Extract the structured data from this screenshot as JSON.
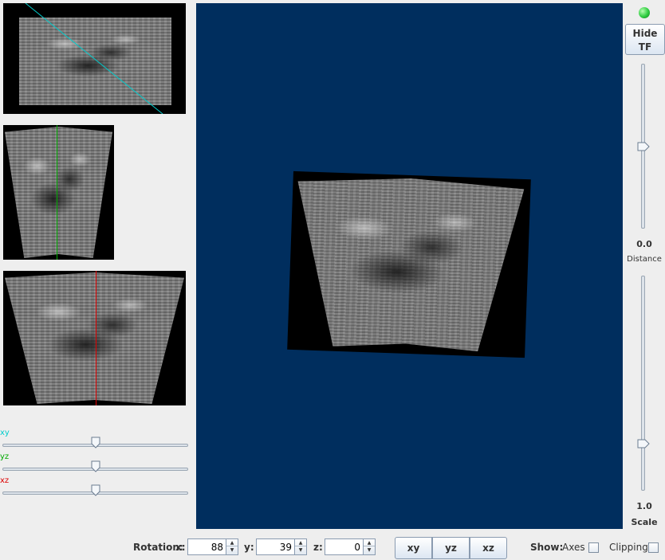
{
  "slices": {
    "xy": {
      "label": "xy",
      "color": "#00cccc"
    },
    "yz": {
      "label": "yz",
      "color": "#00aa00"
    },
    "xz": {
      "label": "xz",
      "color": "#dd0000"
    }
  },
  "sliders": {
    "xy_position": 0.5,
    "yz_position": 0.5,
    "xz_position": 0.5
  },
  "viewport": {
    "background": "#002e5e"
  },
  "right_panel": {
    "status_indicator_color": "#2ecc40",
    "hide_tf_line1": "Hide",
    "hide_tf_line2": "TF",
    "distance_value": "0.0",
    "distance_label": "Distance",
    "distance_position": 0.5,
    "scale_value": "1.0",
    "scale_label": "Scale",
    "scale_position": 0.78
  },
  "bottom": {
    "rotation_label": "Rotation:",
    "x_label": "x:",
    "x_value": "88",
    "y_label": "y:",
    "y_value": "39",
    "z_label": "z:",
    "z_value": "0",
    "btn_xy": "xy",
    "btn_yz": "yz",
    "btn_xz": "xz",
    "show_label": "Show:",
    "axes_label": "Axes",
    "clipping_label": "Clipping"
  }
}
